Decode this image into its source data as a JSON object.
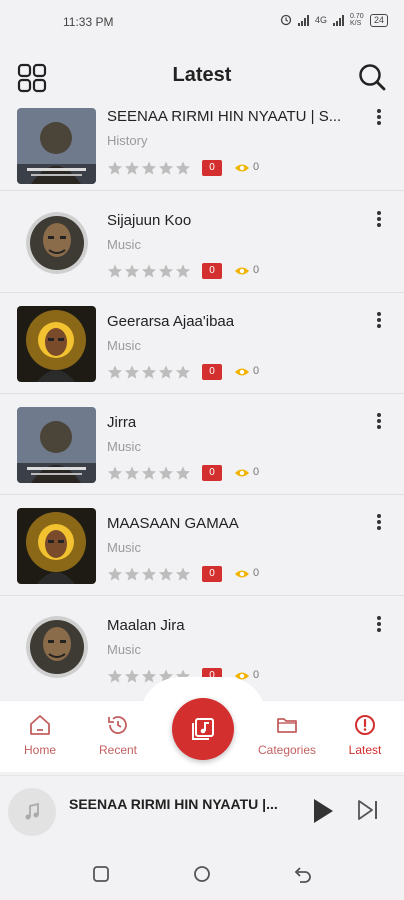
{
  "status_bar": {
    "time": "11:33 PM",
    "network": "4G",
    "speed": "0.70 K/S",
    "battery": "24"
  },
  "header": {
    "title": "Latest"
  },
  "items": [
    {
      "title": "SEENAA RIRMI HIN NYAATU | S...",
      "category": "History",
      "count": "0",
      "views": "0"
    },
    {
      "title": "Sijajuun Koo",
      "category": "Music",
      "count": "0",
      "views": "0"
    },
    {
      "title": "Geerarsa Ajaa'ibaa",
      "category": "Music",
      "count": "0",
      "views": "0"
    },
    {
      "title": "Jirra",
      "category": "Music",
      "count": "0",
      "views": "0"
    },
    {
      "title": "MAASAAN GAMAA",
      "category": "Music",
      "count": "0",
      "views": "0"
    },
    {
      "title": "Maalan Jira",
      "category": "Music",
      "count": "0",
      "views": "0"
    }
  ],
  "rating": {
    "stars_filled": 0,
    "stars_total": 5
  },
  "bottom_nav": {
    "home": "Home",
    "recent": "Recent",
    "categories": "Categories",
    "latest": "Latest"
  },
  "player": {
    "title": "SEENAA RIRMI HIN NYAATU |..."
  },
  "colors": {
    "accent": "#d32f2f",
    "background": "#f2f2f4",
    "star": "#bdbdbd",
    "eye": "#f0b400"
  }
}
